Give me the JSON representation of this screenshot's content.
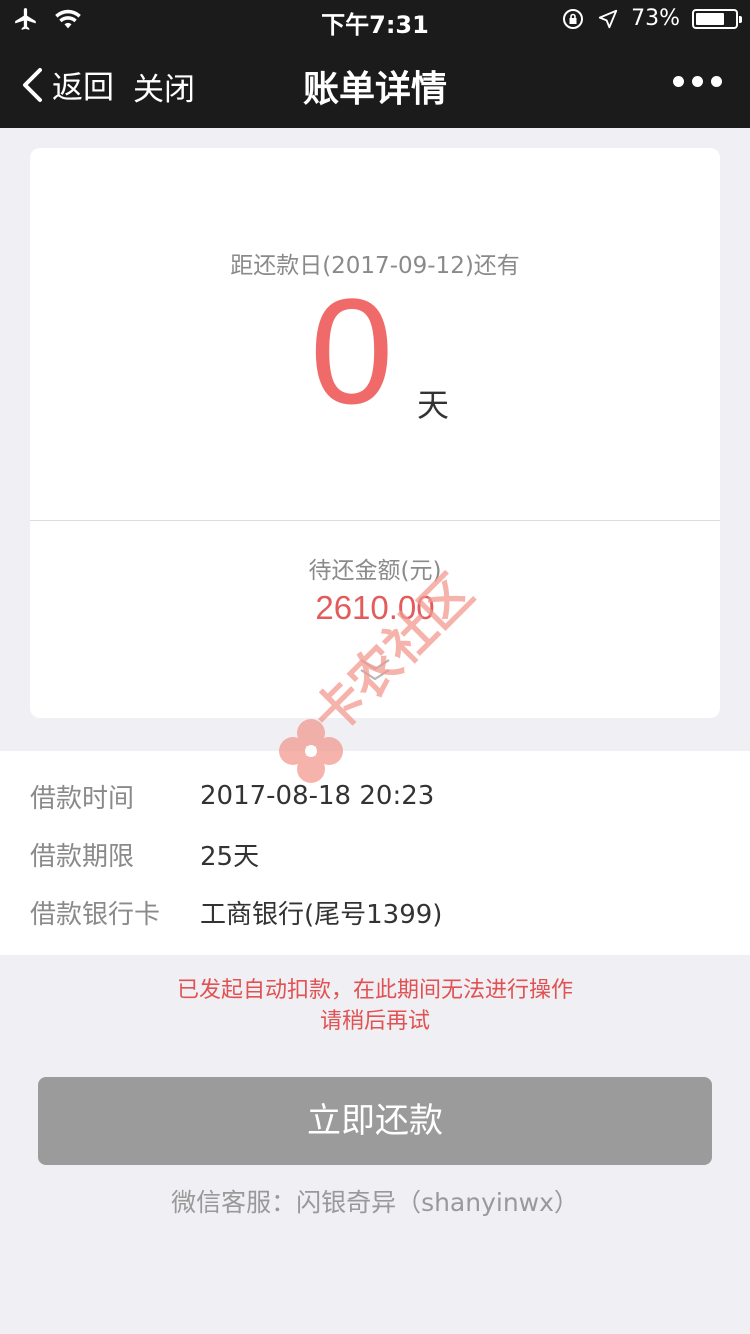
{
  "status_bar": {
    "time": "下午7:31",
    "battery_text": "73%",
    "battery_level": 0.73
  },
  "nav": {
    "back_label": "返回",
    "close_label": "关闭",
    "title": "账单详情"
  },
  "summary": {
    "due_label": "距还款日(2017-09-12)还有",
    "days_value": "0",
    "days_unit": "天",
    "amount_label": "待还金额(元)",
    "amount_value": "2610.00"
  },
  "loan_info": [
    {
      "label": "借款时间",
      "value": "2017-08-18 20:23"
    },
    {
      "label": "借款期限",
      "value": "25天"
    },
    {
      "label": "借款银行卡",
      "value": "工商银行(尾号1399)"
    }
  ],
  "notice": {
    "line1": "已发起自动扣款，在此期间无法进行操作",
    "line2": "请稍后再试"
  },
  "repay_button_label": "立即还款",
  "service_text": "微信客服：闪银奇异（shanyinwx）",
  "watermark_text": "卡农社区",
  "colors": {
    "nav_background": "#1b1b1c",
    "accent_red": "#f06a6a",
    "amount_red": "#e35b5b",
    "button_gray": "#9b9b9b"
  }
}
